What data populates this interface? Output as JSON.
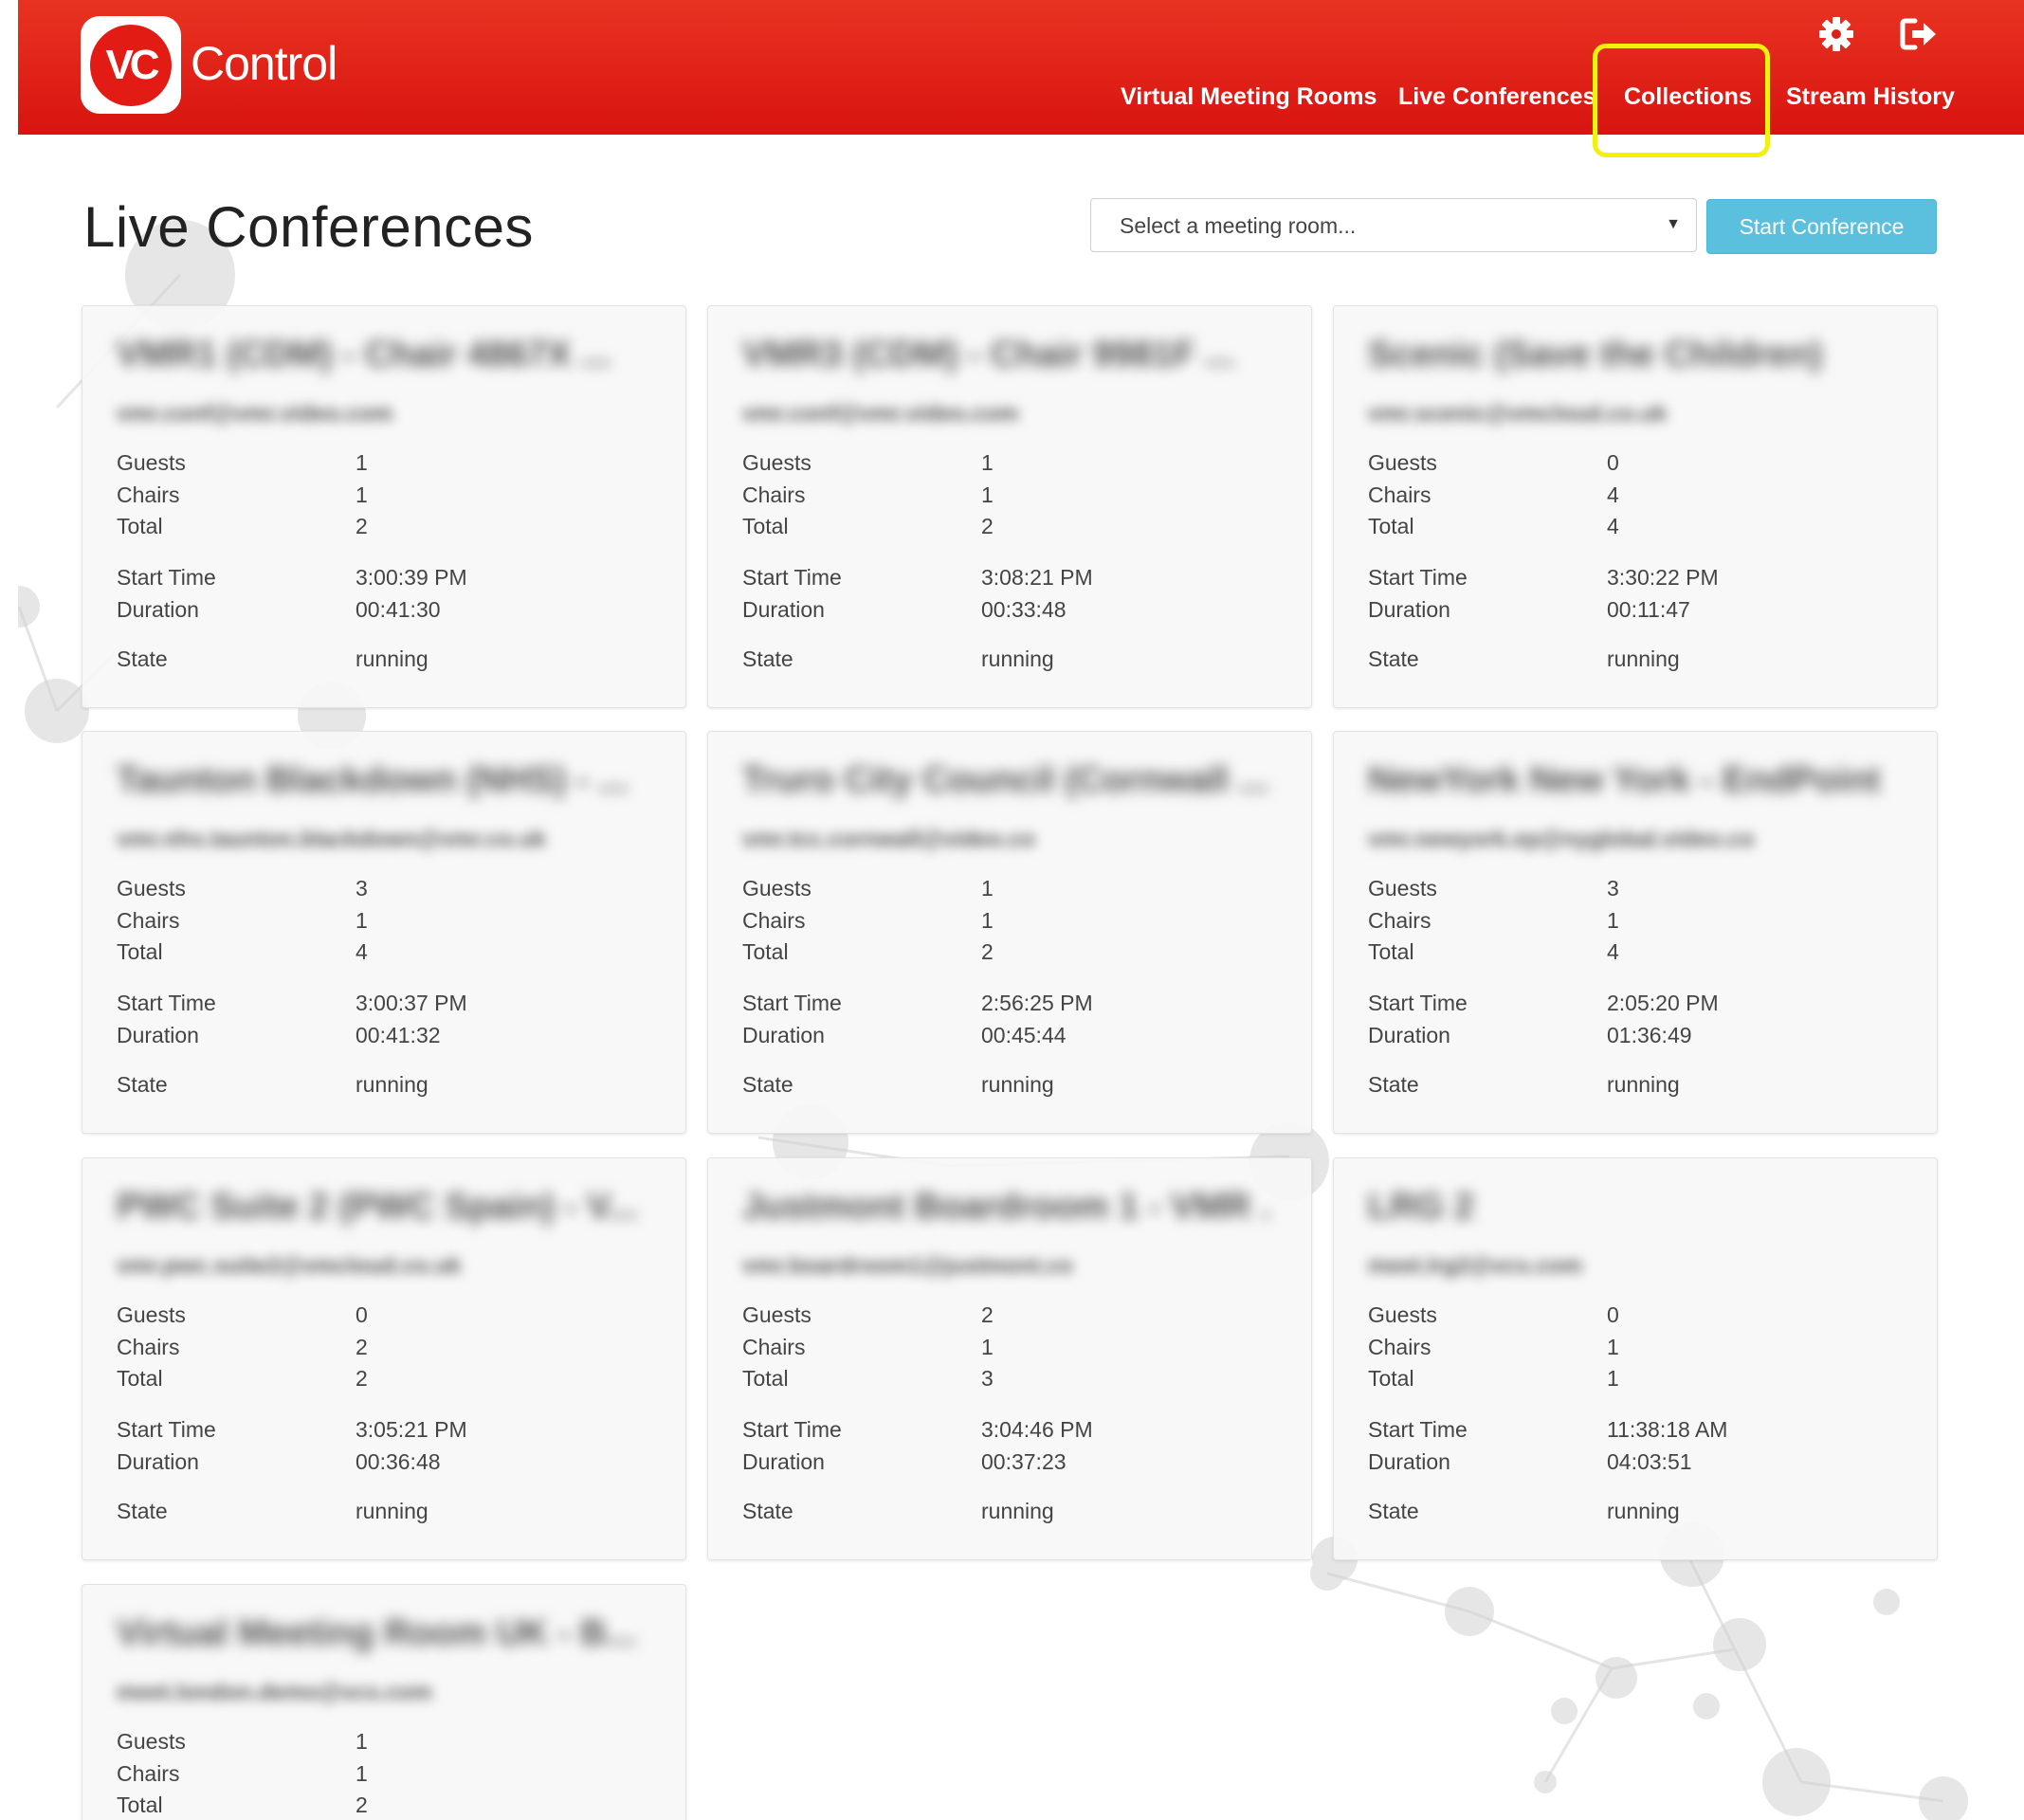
{
  "app": {
    "logo_mark": "VC",
    "logo_text": "Control"
  },
  "nav": {
    "items": [
      "Virtual Meeting Rooms",
      "Live Conferences",
      "Collections",
      "Stream History"
    ],
    "icons": [
      "gear-icon",
      "logout-icon"
    ]
  },
  "page": {
    "title": "Live Conferences",
    "select_placeholder": "Select a meeting room...",
    "start_button": "Start Conference"
  },
  "labels": {
    "guests": "Guests",
    "chairs": "Chairs",
    "total": "Total",
    "start_time": "Start Time",
    "duration": "Duration",
    "state": "State"
  },
  "conferences": [
    {
      "title": "VMR1 (CDM) - Chair 4867X ...",
      "subtitle": "vmr.conf@vmr.video.com",
      "guests": "1",
      "chairs": "1",
      "total": "2",
      "start_time": "3:00:39 PM",
      "duration": "00:41:30",
      "state": "running"
    },
    {
      "title": "VMR3 (CDM) - Chair 9981F ...",
      "subtitle": "vmr.conf@vmr.video.com",
      "guests": "1",
      "chairs": "1",
      "total": "2",
      "start_time": "3:08:21 PM",
      "duration": "00:33:48",
      "state": "running"
    },
    {
      "title": "Scenic (Save the Children)",
      "subtitle": "vmr.scenic@vmcloud.co.uk",
      "guests": "0",
      "chairs": "4",
      "total": "4",
      "start_time": "3:30:22 PM",
      "duration": "00:11:47",
      "state": "running"
    },
    {
      "title": "Taunton Blackdown (NHS) - ...",
      "subtitle": "vmr.nhs.taunton.blackdown@vmr.co.uk",
      "guests": "3",
      "chairs": "1",
      "total": "4",
      "start_time": "3:00:37 PM",
      "duration": "00:41:32",
      "state": "running"
    },
    {
      "title": "Truro City Council (Cornwall ...",
      "subtitle": "vmr.tcc.cornwall@video.co",
      "guests": "1",
      "chairs": "1",
      "total": "2",
      "start_time": "2:56:25 PM",
      "duration": "00:45:44",
      "state": "running"
    },
    {
      "title": "NewYork New York - EndPoint",
      "subtitle": "vmr.newyork.ep@nyglobal.video.co",
      "guests": "3",
      "chairs": "1",
      "total": "4",
      "start_time": "2:05:20 PM",
      "duration": "01:36:49",
      "state": "running"
    },
    {
      "title": "PWC Suite 2 (PWC Spain) - V...",
      "subtitle": "vmr.pwc.suite2@vmcloud.co.uk",
      "guests": "0",
      "chairs": "2",
      "total": "2",
      "start_time": "3:05:21 PM",
      "duration": "00:36:48",
      "state": "running"
    },
    {
      "title": "Justmont Boardroom 1 - VMR ...",
      "subtitle": "vmr.boardroom1@justmont.co",
      "guests": "2",
      "chairs": "1",
      "total": "3",
      "start_time": "3:04:46 PM",
      "duration": "00:37:23",
      "state": "running"
    },
    {
      "title": "LRG 2",
      "subtitle": "meet.lrg2@vcs.com",
      "guests": "0",
      "chairs": "1",
      "total": "1",
      "start_time": "11:38:18 AM",
      "duration": "04:03:51",
      "state": "running"
    },
    {
      "title": "Virtual Meeting Room UK - B...",
      "subtitle": "meet.london.demo@vcs.com",
      "guests": "1",
      "chairs": "1",
      "total": "2",
      "start_time": "",
      "duration": "",
      "state": ""
    }
  ],
  "colors": {
    "header_red": "#e01f17",
    "primary_button": "#5bc0de",
    "highlight": "#f3f00f"
  }
}
